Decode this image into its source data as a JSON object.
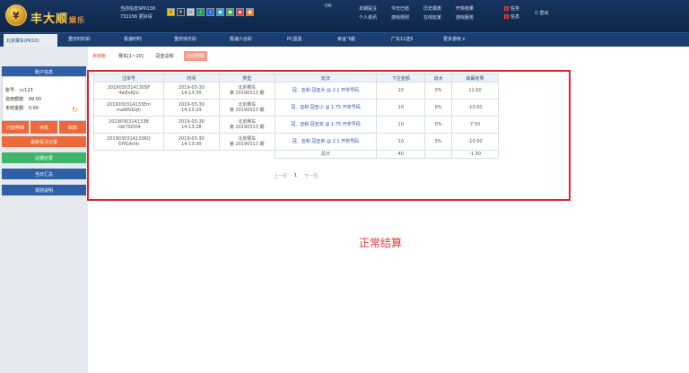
{
  "header": {
    "brand": "丰大顺",
    "brand_suffix": "娱乐",
    "line1": "当前信息SPK138",
    "line2": "732156 更好请",
    "icons": [
      "V",
      "¥",
      "☷",
      "♪",
      "♪",
      "▣",
      "▣",
      "▣",
      "▣"
    ],
    "mid_text": "ON",
    "links": [
      "本期投注",
      "今天已结",
      "历史报表",
      "开奖结果",
      "个人资讯",
      "游戏规则",
      "在线玩家",
      "游戏服务"
    ],
    "right_links": [
      "任务",
      "信息"
    ],
    "logout": "登出"
  },
  "nav": {
    "active": "北京赛车(PK10)",
    "items": [
      "重庆时时彩",
      "极速时时",
      "重庆快乐彩",
      "极速六合彩",
      "PC蛋蛋",
      "幸运飞艇",
      "广东11选5",
      "更多游戏 ▾"
    ]
  },
  "subtabs": [
    "未结账",
    "赛车[1~10]",
    "冠亚总和",
    "已结明细"
  ],
  "sidebar": {
    "title": "账户信息",
    "account_label": "账号:",
    "account_value": "cc123",
    "credit_label": "信用额度:",
    "credit_value": "99.00",
    "balance_label": "未结金额:",
    "balance_value": "0.00",
    "btns": [
      "已结明细",
      "存款",
      "取款"
    ],
    "menu": [
      "最新投注记录",
      "近期记录",
      "当日汇总",
      "规则说明"
    ]
  },
  "table": {
    "headers": [
      "注单号",
      "时间",
      "类型",
      "玩法",
      "下注金额",
      "退水",
      "输赢结果"
    ],
    "rows": [
      {
        "id1": "2019030314130SF",
        "id2": "4wExKJvl",
        "t1": "2019-03-30",
        "t2": "14:13:30",
        "type1": "北京赛车",
        "type2": "第 20190313 期",
        "play": "冠、亚和 冠亚大 @ 2.1 开奖号码",
        "amt": "10",
        "rebate": "0%",
        "result": "11.00"
      },
      {
        "id1": "2019030314133Em",
        "id2": "maWGGqh",
        "t1": "2019-03-30",
        "t2": "14:13:29",
        "type1": "北京赛车",
        "type2": "第 20190313 期",
        "play": "冠、亚和 冠亚小 @ 1.75 开奖号码",
        "amt": "10",
        "rebate": "0%",
        "result": "-10.00"
      },
      {
        "id1": "2019030314133B",
        "id2": "-GK7SDO4",
        "t1": "2019-03-30",
        "t2": "14:13:28",
        "type1": "北京赛车",
        "type2": "第 20190313 期",
        "play": "冠、亚和 冠亚双 @ 1.75 开奖号码",
        "amt": "10",
        "rebate": "0%",
        "result": "7.50"
      },
      {
        "id1": "2019030314133RQ",
        "id2": "SYfGAmh",
        "t1": "2019-03-30",
        "t2": "14:13:30",
        "type1": "北京赛车",
        "type2": "第 20190313 期",
        "play": "冠、亚和 冠亚单 @ 2.1 开奖号码",
        "amt": "10",
        "rebate": "0%",
        "result": "-10.00"
      }
    ],
    "total_label": "总计",
    "total_amt": "40",
    "total_result": "-1.50"
  },
  "pager": {
    "prev": "上一页",
    "current": "1",
    "next": "下一页"
  },
  "notice": "正常结算",
  "colors": {
    "header": "#16345f",
    "accent": "#e0242e",
    "sidebar_orange": "#ec6a3a",
    "sidebar_green": "#3fb56a",
    "sidebar_blue": "#2f5fa6"
  }
}
